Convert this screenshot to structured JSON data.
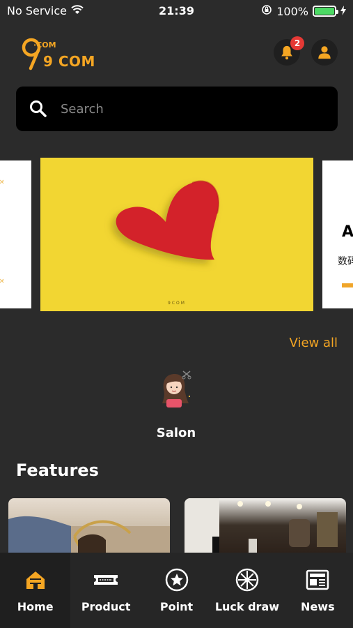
{
  "status": {
    "carrier": "No Service",
    "time": "21:39",
    "battery": "100%"
  },
  "header": {
    "logo_text": "9 COM",
    "logo_dotcom": "·COM",
    "notification_count": "2"
  },
  "search": {
    "placeholder": "Search"
  },
  "carousel": {
    "right_letter": "A",
    "right_subtitle": "数码",
    "caption": "9COM"
  },
  "categories": {
    "view_all": "View all",
    "items": [
      {
        "label": "Salon"
      }
    ]
  },
  "features": {
    "title": "Features"
  },
  "nav": {
    "items": [
      {
        "label": "Home"
      },
      {
        "label": "Product"
      },
      {
        "label": "Point"
      },
      {
        "label": "Luck draw"
      },
      {
        "label": "News"
      }
    ]
  },
  "colors": {
    "accent": "#f5a623",
    "background": "#2b2b2b"
  }
}
